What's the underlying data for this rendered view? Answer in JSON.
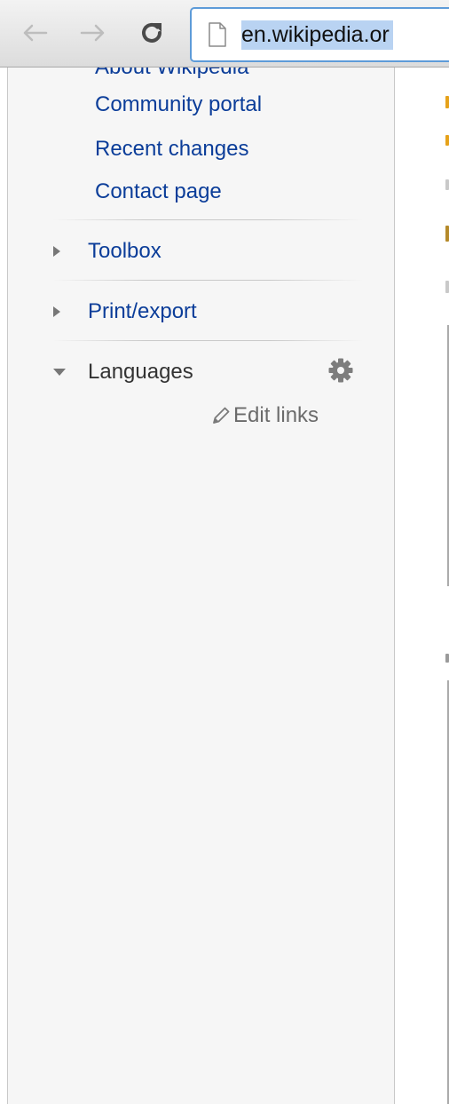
{
  "browser": {
    "url": "en.wikipedia.or",
    "icons": {
      "back": "arrow-left-icon",
      "forward": "arrow-right-icon",
      "reload": "reload-icon",
      "page": "page-icon"
    }
  },
  "sidebar": {
    "navigation": {
      "partially_visible_item": "About Wikipedia",
      "items": [
        "Community portal",
        "Recent changes",
        "Contact page"
      ]
    },
    "portals": [
      {
        "label": "Toolbox",
        "state": "collapsed"
      },
      {
        "label": "Print/export",
        "state": "collapsed"
      },
      {
        "label": "Languages",
        "state": "expanded"
      }
    ],
    "languages": {
      "settings_icon": "gear-icon",
      "edit_links_icon": "pencil-icon",
      "edit_links_label": "Edit links"
    }
  },
  "colors": {
    "link": "#0b3d99",
    "sidebar_bg": "#f6f6f6",
    "url_highlight": "#b9d3f2",
    "omnibox_focus_border": "#5d9bd8"
  }
}
